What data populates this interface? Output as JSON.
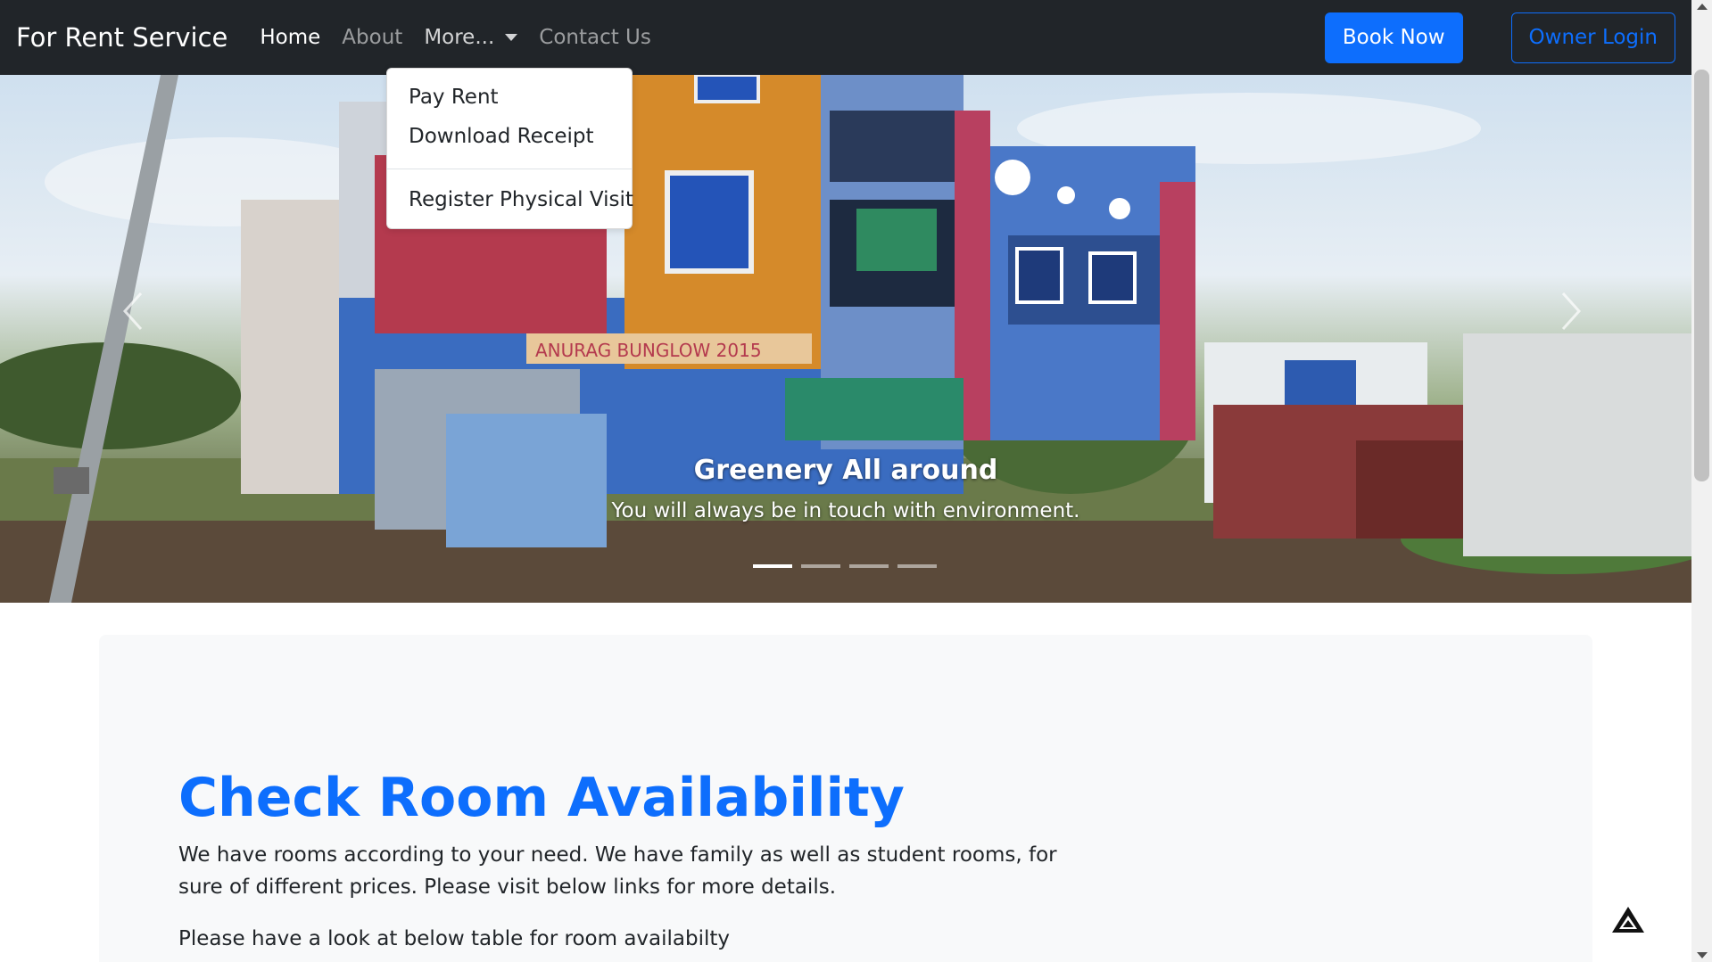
{
  "navbar": {
    "brand": "For Rent Service",
    "links": [
      {
        "label": "Home"
      },
      {
        "label": "About"
      },
      {
        "label": "More..."
      },
      {
        "label": "Contact Us"
      }
    ],
    "book_label": "Book Now",
    "owner_label": "Owner Login"
  },
  "dropdown": {
    "items": [
      {
        "label": "Pay Rent"
      },
      {
        "label": "Download Receipt"
      },
      {
        "label": "Register Physical Visit"
      }
    ]
  },
  "carousel": {
    "caption_title": "Greenery All around",
    "caption_text": "You will always be in touch with environment.",
    "indicator_count": 4,
    "active_index": 0,
    "sign_text": "ANURAG BUNGLOW 2015"
  },
  "main": {
    "heading": "Check Room Availability",
    "lead": "We have rooms according to your need. We have family as well as student rooms, for sure of different prices. Please visit below links for more details.",
    "sub": "Please have a look at below table for room availabilty"
  },
  "colors": {
    "primary": "#0d6efd",
    "navbar_bg": "#212529",
    "jumbotron_bg": "#f8f9fa"
  },
  "icons": {
    "back_to_top": "triangle-up-icon",
    "carousel_prev": "chevron-left-icon",
    "carousel_next": "chevron-right-icon"
  }
}
